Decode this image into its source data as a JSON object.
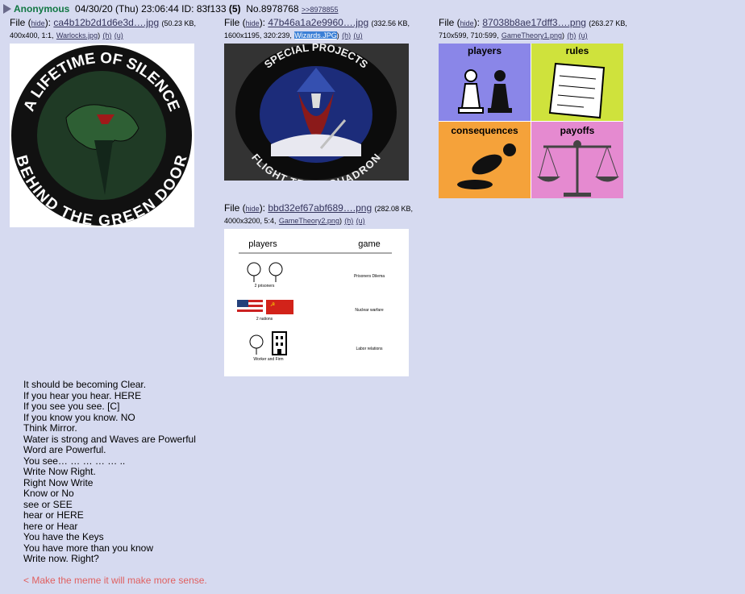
{
  "post": {
    "name": "Anonymous",
    "date": "04/30/20 (Thu) 23:06:44",
    "id_label": "ID:",
    "id": "83f133",
    "id_count": "(5)",
    "no": "No.8978768",
    "backlink": ">>8978855"
  },
  "files": [
    {
      "label": "File (",
      "hide": "hide",
      "sep": "):",
      "name": "ca4b12b2d1d6e3d….jpg",
      "meta1": "(50.23 KB,",
      "meta2": "400x400, 1:1,",
      "orig": "Warlocks.jpg",
      "h": "(h)",
      "u": "(u)"
    },
    {
      "label": "File (",
      "hide": "hide",
      "sep": "):",
      "name": "47b46a1a2e9960….jpg",
      "meta1": "(332.56 KB,",
      "meta2": "1600x1195, 320:239,",
      "orig": "Wizards.JPG",
      "h": "(h)",
      "u": "(u)"
    },
    {
      "label": "File (",
      "hide": "hide",
      "sep": "):",
      "name": "87038b8ae17dff3….png",
      "meta1": "(263.27 KB,",
      "meta2": "710x599, 710:599,",
      "orig": "GameTheory1.png",
      "h": "(h)",
      "u": "(u)"
    },
    {
      "label": "File (",
      "hide": "hide",
      "sep": "):",
      "name": "bbd32ef67abf689….png",
      "meta1": "(282.08 KB,",
      "meta2": "4000x3200, 5:4,",
      "orig": "GameTheory2.png",
      "h": "(h)",
      "u": "(u)"
    }
  ],
  "patch1": {
    "top": "A LIFETIME OF SILENCE",
    "bottom": "BEHIND THE GREEN DOOR"
  },
  "patch2": {
    "top": "SPECIAL PROJECTS",
    "bottom": "FLIGHT TEST SQUADRON"
  },
  "gt1": {
    "q1": "players",
    "q2": "rules",
    "q3": "consequences",
    "q4": "payoffs"
  },
  "gt2": {
    "col1": "players",
    "col2": "game",
    "rows": [
      {
        "who": "2 prisoners",
        "game": "Prisoners Dilema"
      },
      {
        "who": "2 nations",
        "game": "Nuclear warfare"
      },
      {
        "who": "Worker and Firm",
        "game": "Labor relations"
      }
    ]
  },
  "message": [
    "It should be becoming Clear.",
    "If you hear you hear. HERE",
    "If you see you see. [C]",
    "If you know you know. NO",
    "Think Mirror.",
    "Water is strong and Waves are Powerful",
    "Word are Powerful.",
    "You see… … … … … ..",
    "Write Now Right.",
    "Right Now Write",
    "Know or No",
    "see or SEE",
    "hear or HERE",
    "here or Hear",
    "You have the Keys",
    "You have more than you know",
    "Write now. Right?"
  ],
  "greentext": "< Make the meme it will make more sense."
}
